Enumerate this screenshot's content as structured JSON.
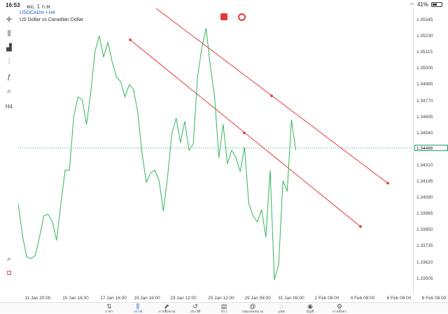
{
  "status_bar": {
    "time": "16:53",
    "date": "พฤ. 1 ก.พ.",
    "battery": "41%",
    "battery_level": 0.41
  },
  "symbol": {
    "name": "USDCADm • H4",
    "description": "US Dollar vs Canadian Dollar"
  },
  "left_toolbar": [
    {
      "icon": "crosshair-icon",
      "glyph": "✛"
    },
    {
      "icon": "candlestick-icon",
      "glyph": "⫼"
    },
    {
      "icon": "bar-chart-icon",
      "glyph": "▟"
    },
    {
      "icon": "indicators-icon",
      "glyph": "⫶"
    },
    {
      "icon": "function-icon",
      "glyph": "ƒ"
    },
    {
      "icon": "objects-icon",
      "glyph": "⌕"
    },
    {
      "icon": "timeframe-icon",
      "glyph": "H4"
    }
  ],
  "side_icons": [
    {
      "icon": "search-chart-icon",
      "glyph": "⌕"
    }
  ],
  "price_axis": [
    "1.35345",
    "1.35230",
    "1.35115",
    "1.35000",
    "1.34885",
    "1.34770",
    "1.34655",
    "1.34540",
    "1.34425",
    "1.34310",
    "1.34195",
    "1.34080",
    "1.33965",
    "1.33850",
    "1.33735",
    "1.33620",
    "1.33505"
  ],
  "current_price": "1.34466",
  "time_axis": [
    "11 Jan 20:00",
    "15 Jan 16:00",
    "17 Jan 16:00",
    "19 Jan 16:00",
    "23 Jan 12:00",
    "25 Jan 12:00",
    "29 Jan 08:00",
    "31 Jan 08:00",
    "2 Feb 08:00",
    "4 Feb 08:00",
    "6 Feb 08:00",
    "8 Feb 08:00"
  ],
  "tabs": [
    {
      "icon": "quotes-icon",
      "glyph": "⇅",
      "label": "ราคา"
    },
    {
      "icon": "chart-icon",
      "glyph": "⫼",
      "label": "กราฟ",
      "active": true
    },
    {
      "icon": "trade-icon",
      "glyph": "⬈",
      "label": "การซื้อขาย"
    },
    {
      "icon": "history-icon",
      "glyph": "↺",
      "label": "ประวัติ"
    },
    {
      "icon": "news-icon",
      "glyph": "▤",
      "label": "ข่าว"
    },
    {
      "icon": "mailbox-icon",
      "glyph": "@",
      "label": "กล่องจดหมาย"
    },
    {
      "icon": "chat-icon",
      "glyph": "◌",
      "label": "แชท"
    },
    {
      "icon": "account-icon",
      "glyph": "◉",
      "label": "บัญชี"
    },
    {
      "icon": "settings-icon",
      "glyph": "⚙",
      "label": "การตั้งค่า"
    }
  ],
  "colors": {
    "accent": "#1e62c8",
    "price_line": "#2fb65a",
    "trend_line": "#e02b2b",
    "current_price_line": "#1e9c6b"
  },
  "chart_data": {
    "type": "line",
    "series": [
      {
        "values": [
          1.341,
          1.3389,
          1.3375,
          1.3374,
          1.3376,
          1.3388,
          1.3402,
          1.3403,
          1.3398,
          1.3386,
          1.341,
          1.3432,
          1.3432,
          1.3467,
          1.348,
          1.3478,
          1.3462,
          1.3483,
          1.351,
          1.352,
          1.3506,
          1.3516,
          1.3503,
          1.3493,
          1.349,
          1.348,
          1.3488,
          1.3485,
          1.347,
          1.3443,
          1.3424,
          1.343,
          1.3432,
          1.3425,
          1.3405,
          1.3428,
          1.3456,
          1.3466,
          1.345,
          1.3464,
          1.3445,
          1.3449,
          1.3493,
          1.3512,
          1.3525,
          1.35,
          1.348,
          1.344,
          1.3462,
          1.3436,
          1.3445,
          1.344,
          1.3431,
          1.3447,
          1.341,
          1.3402,
          1.3398,
          1.3406,
          1.3388,
          1.3432,
          1.336,
          1.337,
          1.3425,
          1.3418,
          1.3465,
          1.3445
        ]
      }
    ],
    "trend_lines": [
      {
        "from": [
          "2023-01-16 08:00",
          1.3537
        ],
        "to": [
          "2023-02-05 12:00",
          1.3407
        ]
      },
      {
        "from": [
          "2023-01-18 12:00",
          1.3523
        ],
        "to": [
          "2023-02-03 08:00",
          1.3377
        ]
      }
    ],
    "ylim": [
      1.335,
      1.3538
    ]
  }
}
